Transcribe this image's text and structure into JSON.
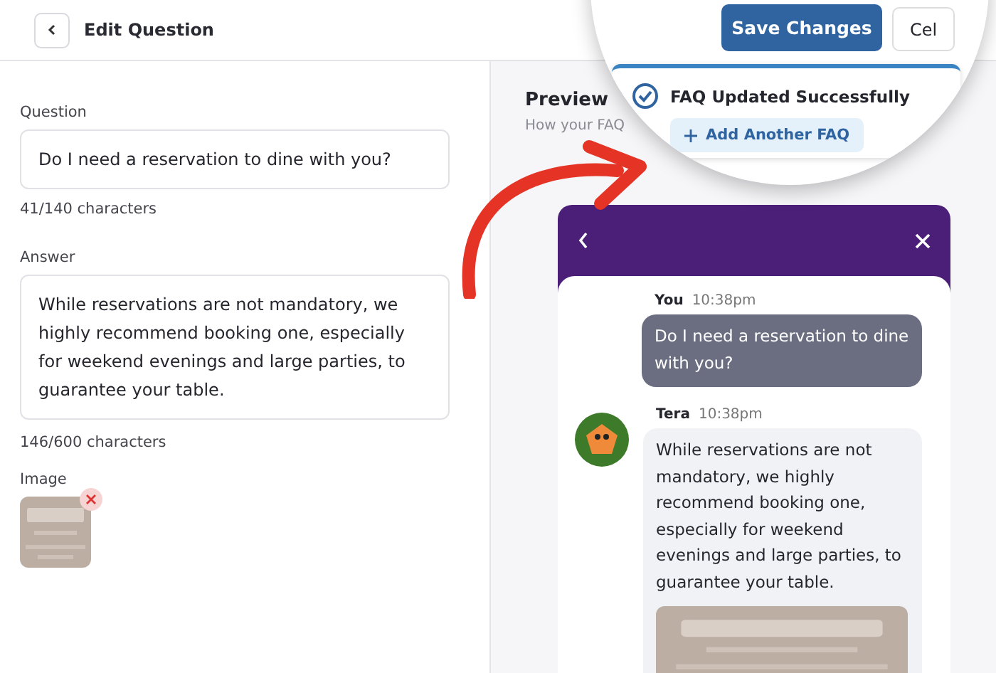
{
  "header": {
    "title": "Edit Question",
    "save_button": "Save Changes",
    "cancel_button": "Cel"
  },
  "toast": {
    "message": "FAQ Updated Successfully",
    "action": "Add Another FAQ"
  },
  "form": {
    "question_label": "Question",
    "question": "Do I need a reservation to dine with you?",
    "question_count": "41/140 characters",
    "answer_label": "Answer",
    "answer": "While reservations are not mandatory, we highly recommend booking one, especially for weekend evenings and large parties, to guarantee your table.",
    "answer_count": "146/600 characters",
    "image_label": "Image"
  },
  "preview": {
    "title": "Preview",
    "subtitle": "How your FAQ",
    "messages": [
      {
        "kind": "user",
        "sender": "You",
        "time": "10:38pm",
        "text": "Do I need a reservation to dine with you?"
      },
      {
        "kind": "bot",
        "sender": "Tera",
        "time": "10:38pm",
        "text": "While reservations are not mandatory, we highly recommend booking one, especially for weekend evenings and large parties, to guarantee your table."
      }
    ]
  }
}
